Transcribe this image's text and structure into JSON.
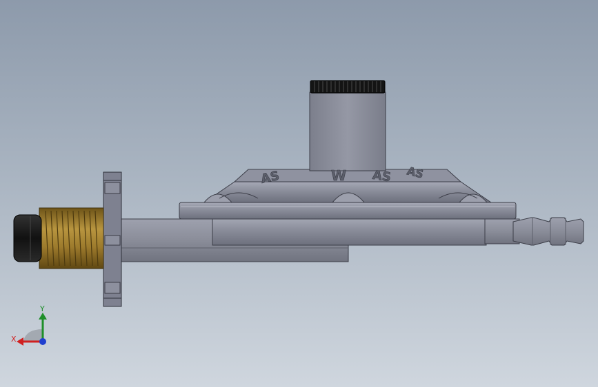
{
  "viewport": {
    "background_top": "#8d9aab",
    "background_bottom": "#cfd6de"
  },
  "model": {
    "body_color": "#7d808e",
    "body_highlight": "#a6a9b6",
    "brass_color": "#9a7a2e",
    "cap_color": "#1a1a1a",
    "embossed_text": [
      "AS",
      "W",
      "AS",
      "AS"
    ]
  },
  "triad": {
    "x_label": "X",
    "y_label": "Y",
    "x_color": "#d02020",
    "y_color": "#1f8f2a",
    "z_color": "#1f3fcf"
  }
}
